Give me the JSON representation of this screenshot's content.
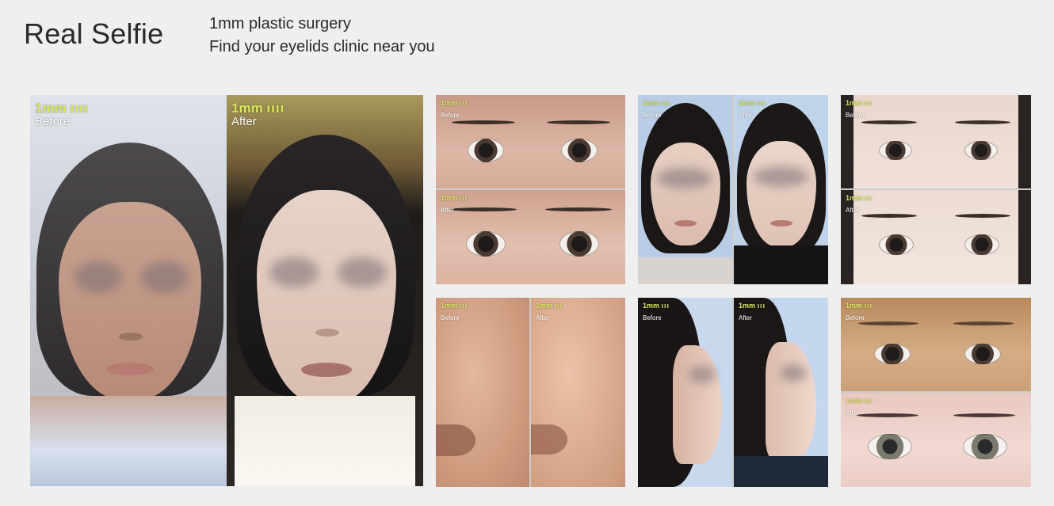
{
  "header": {
    "title": "Real Selfie",
    "subtitle_line1": "1mm plastic surgery",
    "subtitle_line2": "Find your eyelids clinic near you"
  },
  "logo_text": "1mm",
  "gallery": [
    {
      "id": "face-lift",
      "before": "Before",
      "after": "After"
    },
    {
      "id": "eyelids-1",
      "before": "Before",
      "after": "After"
    },
    {
      "id": "face-front",
      "before": "Before",
      "after": "After"
    },
    {
      "id": "eyelids-2",
      "before": "Before",
      "after": "After"
    },
    {
      "id": "skin",
      "before": "Before",
      "after": "After"
    },
    {
      "id": "nose-profile",
      "before": "Before",
      "after": "After"
    },
    {
      "id": "eyelids-3",
      "before": "Before",
      "after": "After"
    }
  ],
  "colors": {
    "background": "#efefef",
    "logo_accent": "#d9e85a"
  }
}
